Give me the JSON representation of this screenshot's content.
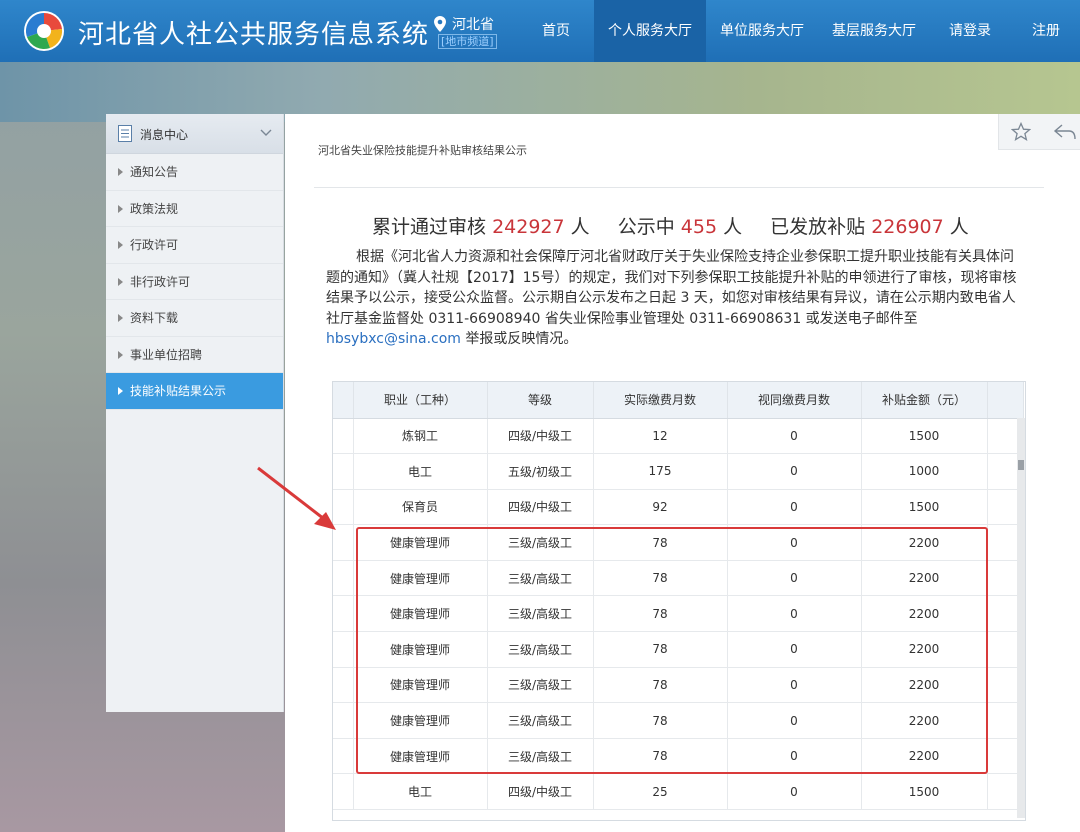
{
  "header": {
    "site_title": "河北省人社公共服务信息系统",
    "location": "河北省",
    "location_sub": "[地市频道]",
    "nav": [
      {
        "label": "首页",
        "active": false
      },
      {
        "label": "个人服务大厅",
        "active": true
      },
      {
        "label": "单位服务大厅",
        "active": false
      },
      {
        "label": "基层服务大厅",
        "active": false
      },
      {
        "label": "请登录",
        "active": false
      },
      {
        "label": "注册",
        "active": false
      }
    ]
  },
  "sidebar": {
    "title": "消息中心",
    "items": [
      {
        "label": "通知公告"
      },
      {
        "label": "政策法规"
      },
      {
        "label": "行政许可"
      },
      {
        "label": "非行政许可"
      },
      {
        "label": "资料下载"
      },
      {
        "label": "事业单位招聘"
      },
      {
        "label": "技能补贴结果公示",
        "active": true
      }
    ]
  },
  "main": {
    "breadcrumb": "河北省失业保险技能提升补贴审核结果公示",
    "stats": {
      "label1": "累计通过审核",
      "value1": "242927",
      "unit1": "人",
      "label2": "公示中",
      "value2": "455",
      "unit2": "人",
      "label3": "已发放补贴",
      "value3": "226907",
      "unit3": "人"
    },
    "notice_text": "根据《河北省人力资源和社会保障厅河北省财政厅关于失业保险支持企业参保职工提升职业技能有关具体问题的通知》（冀人社规【2017】15号）的规定，我们对下列参保职工技能提升补贴的申领进行了审核，现将审核结果予以公示，接受公众监督。公示期自公示发布之日起 3 天，如您对审核结果有异议，请在公示期内致电省人社厅基金监督处 0311-66908940 省失业保险事业管理处 0311-66908631 或发送电子邮件至",
    "notice_email": "hbsybxc@sina.com",
    "notice_tail": "举报或反映情况。"
  },
  "table": {
    "headers": [
      "职业（工种）",
      "等级",
      "实际缴费月数",
      "视同缴费月数",
      "补贴金额（元）"
    ],
    "rows": [
      [
        "炼钢工",
        "四级/中级工",
        "12",
        "0",
        "1500"
      ],
      [
        "电工",
        "五级/初级工",
        "175",
        "0",
        "1000"
      ],
      [
        "保育员",
        "四级/中级工",
        "92",
        "0",
        "1500"
      ],
      [
        "健康管理师",
        "三级/高级工",
        "78",
        "0",
        "2200"
      ],
      [
        "健康管理师",
        "三级/高级工",
        "78",
        "0",
        "2200"
      ],
      [
        "健康管理师",
        "三级/高级工",
        "78",
        "0",
        "2200"
      ],
      [
        "健康管理师",
        "三级/高级工",
        "78",
        "0",
        "2200"
      ],
      [
        "健康管理师",
        "三级/高级工",
        "78",
        "0",
        "2200"
      ],
      [
        "健康管理师",
        "三级/高级工",
        "78",
        "0",
        "2200"
      ],
      [
        "健康管理师",
        "三级/高级工",
        "78",
        "0",
        "2200"
      ],
      [
        "电工",
        "四级/中级工",
        "25",
        "0",
        "1500"
      ]
    ]
  },
  "colors": {
    "header_blue": "#2f86cb",
    "nav_active": "#1a63a6",
    "sidebar_active": "#3a9be0",
    "stat_number": "#c9353a",
    "highlight_red": "#d93a3a",
    "link": "#2a6fc0"
  }
}
